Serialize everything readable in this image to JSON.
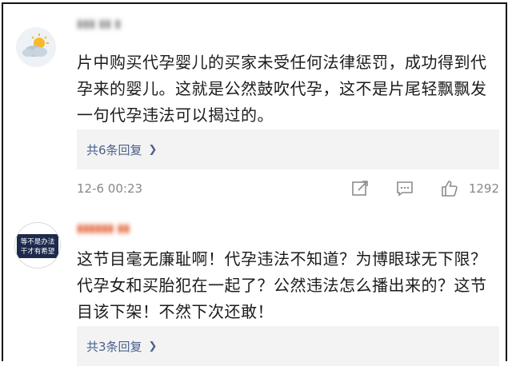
{
  "comments": [
    {
      "content": "片中购买代孕婴儿的买家未受任何法律惩罚，成功得到代孕来的婴儿。这就是公然鼓吹代孕，这不是片尾轻飘飘发一句代孕违法可以揭过的。",
      "replies_label": "共6条回复",
      "timestamp": "12-6 00:23",
      "like_count": "1292",
      "icons": [
        "share-icon",
        "comment-icon",
        "like-icon"
      ]
    },
    {
      "content": "这节目毫无廉耻啊！代孕违法不知道？为博眼球无下限？代孕女和买胎犯在一起了？公然违法怎么播出来的？这节目该下架！不然下次还敢！",
      "replies_label": "共3条回复",
      "avatar_text": [
        "等不是办法",
        "干才有希望"
      ]
    }
  ],
  "colors": {
    "link": "#49608c",
    "text": "#1b1b1b",
    "meta": "#888888",
    "reply_bg": "#f3f3f3"
  }
}
